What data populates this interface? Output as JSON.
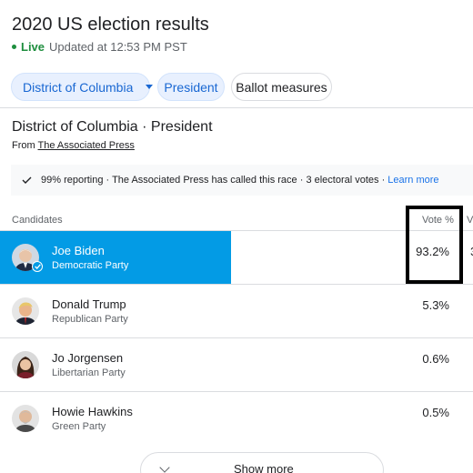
{
  "header": {
    "title": "2020 US election results",
    "live_label": "Live",
    "updated": "Updated at 12:53 PM PST"
  },
  "filters": {
    "state": "District of Columbia",
    "office": "President",
    "ballot": "Ballot measures"
  },
  "race": {
    "title": "District of Columbia · President",
    "source_prefix": "From ",
    "source": "The Associated Press",
    "status": "99% reporting · The Associated Press has called this race · 3 electoral votes ·",
    "learn_more": "Learn more"
  },
  "table": {
    "col_candidates": "Candidates",
    "col_vote_pct": "Vote %",
    "col_votes_cut": "V",
    "winner_votes_cut": "3",
    "rows": [
      {
        "name": "Joe Biden",
        "party": "Democratic Party",
        "pct": "93.2%",
        "winner": true
      },
      {
        "name": "Donald Trump",
        "party": "Republican Party",
        "pct": "5.3%",
        "winner": false
      },
      {
        "name": "Jo Jorgensen",
        "party": "Libertarian Party",
        "pct": "0.6%",
        "winner": false
      },
      {
        "name": "Howie Hawkins",
        "party": "Green Party",
        "pct": "0.5%",
        "winner": false
      }
    ]
  },
  "show_more": "Show more",
  "colors": {
    "winner_highlight": "#039be5",
    "live": "#1e8e3e",
    "link": "#1a73e8",
    "chip_selected_bg": "#e8f0fe"
  }
}
